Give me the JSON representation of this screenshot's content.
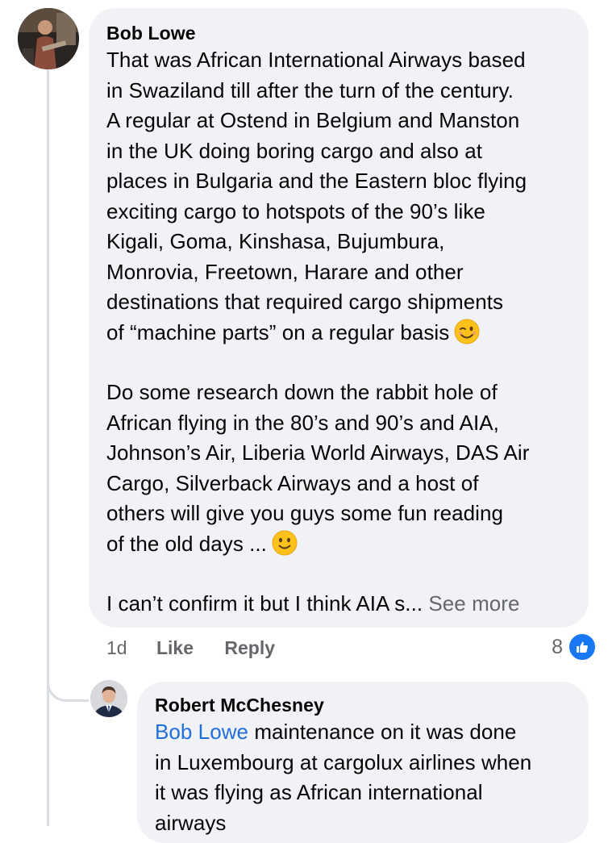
{
  "comment": {
    "author": "Bob Lowe",
    "paragraphs": [
      {
        "lines": [
          "That was African International Airways based",
          "in Swaziland till after the turn of the century.",
          "A regular at Ostend in Belgium and Manston",
          "in the UK doing boring cargo and also at",
          "places in Bulgaria and the Eastern bloc flying",
          "exciting cargo to hotspots of the 90’s like",
          "Kigali, Goma, Kinshasa, Bujumbura,",
          "Monrovia, Freetown, Harare and other",
          "destinations that required cargo shipments",
          "of “machine parts” on a regular basis"
        ],
        "emoji": "winking-face-emoji"
      },
      {
        "lines": [
          "Do some research down the rabbit hole of",
          "African flying in the 80’s and 90’s and AIA,",
          "Johnson’s Air, Liberia World Airways, DAS Air",
          "Cargo, Silverback Airways and a host of",
          "others will give you guys some fun reading",
          "of the old days ..."
        ],
        "emoji": "slightly-smiling-face-emoji"
      },
      {
        "lines": [
          "I can’t confirm it but I think AIA s..."
        ],
        "see_more": "See more"
      }
    ],
    "actions": {
      "time": "1d",
      "like": "Like",
      "reply": "Reply"
    },
    "reaction_count": "8",
    "reaction_icon": "thumbs-up-icon",
    "colors": {
      "bubble": "#f0f2f5",
      "secondary_text": "#65676b",
      "like_blue": "#1877f2"
    }
  },
  "reply": {
    "author": "Robert McChesney",
    "mention": "Bob Lowe",
    "lines": [
      " maintenance on it was done",
      "in Luxembourg at cargolux airlines when",
      "it was flying as African international",
      "airways"
    ],
    "colors": {
      "mention": "#216fdb"
    }
  }
}
